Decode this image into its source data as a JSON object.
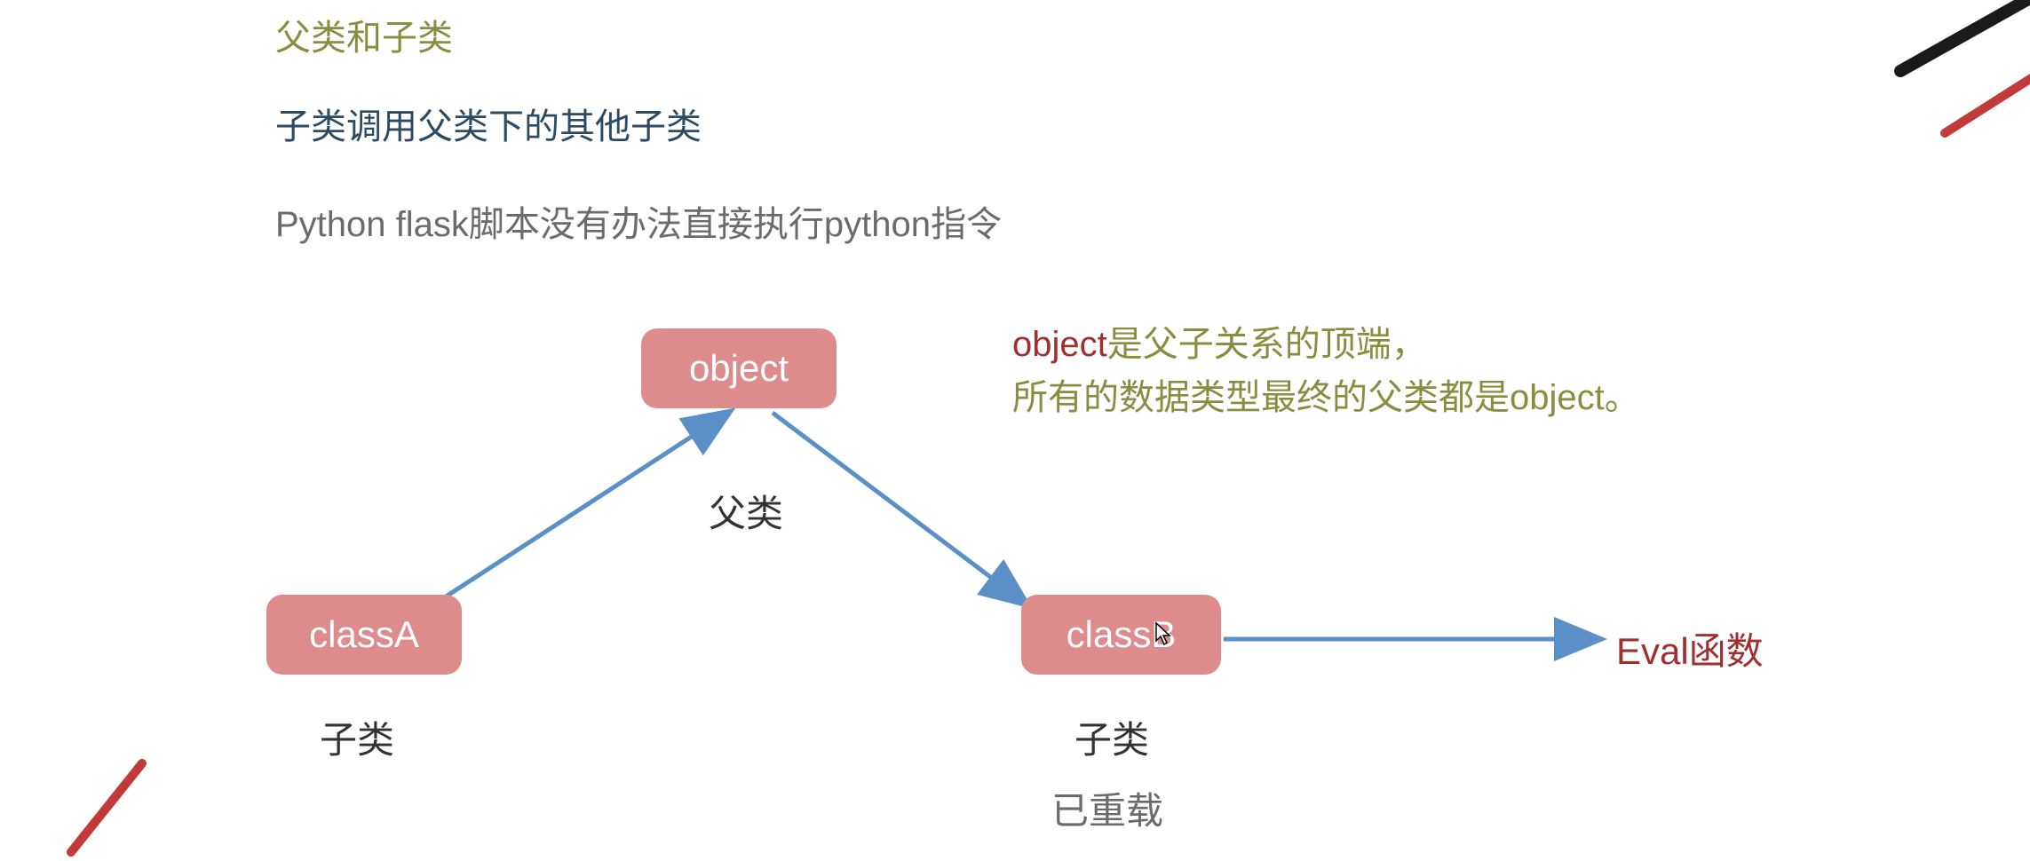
{
  "headings": {
    "title1": "父类和子类",
    "title2": "子类调用父类下的其他子类",
    "title3": "Python flask脚本没有办法直接执行python指令"
  },
  "nodes": {
    "object": "object",
    "classA": "classA",
    "classB": "classB"
  },
  "labels": {
    "parent": "父类",
    "childA": "子类",
    "childB": "子类",
    "overloaded": "已重载"
  },
  "note": {
    "part1": "object",
    "part2": "是父子关系的顶端，",
    "part3": "所有的数据类型最终的父类都是object。"
  },
  "eval": "Eval函数",
  "colors": {
    "olive": "#8a8c3f",
    "darkBlue": "#2d4a63",
    "gray": "#6b6b6b",
    "nodeBg": "#dd8b8b",
    "accent": "#a03030",
    "arrow": "#5b8fc7"
  }
}
